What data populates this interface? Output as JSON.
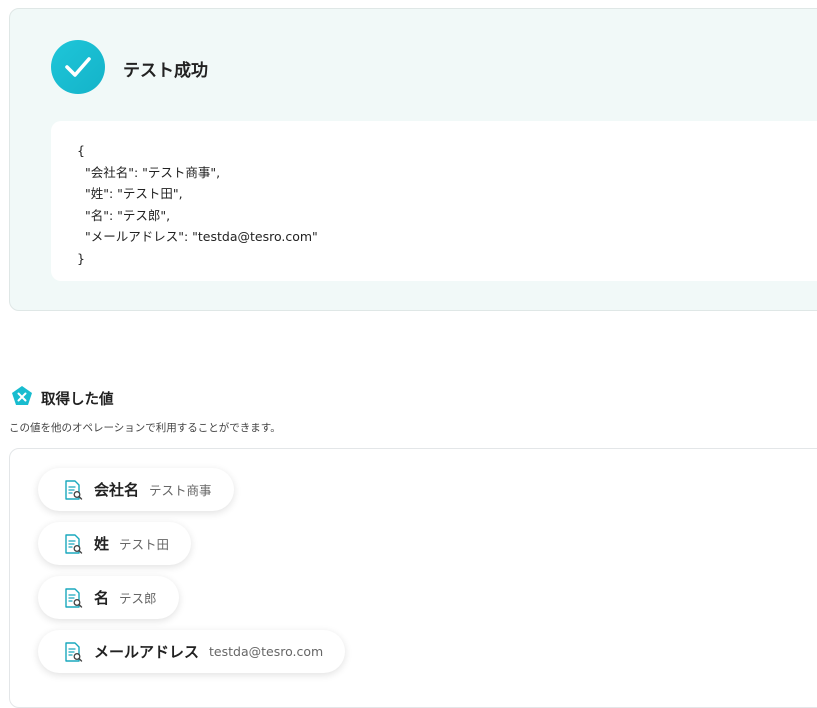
{
  "test_result": {
    "title": "テスト成功",
    "json_lines": [
      "{",
      "  \"会社名\": \"テスト商事\",",
      "  \"姓\": \"テスト田\",",
      "  \"名\": \"テス郎\",",
      "  \"メールアドレス\": \"testda@tesro.com\"",
      "}"
    ]
  },
  "acquired": {
    "title": "取得した値",
    "description": "この値を他のオペレーションで利用することができます。",
    "items": [
      {
        "label": "会社名",
        "value": "テスト商事"
      },
      {
        "label": "姓",
        "value": "テスト田"
      },
      {
        "label": "名",
        "value": "テス郎"
      },
      {
        "label": "メールアドレス",
        "value": "testda@tesro.com"
      }
    ]
  },
  "colors": {
    "accent": "#18bccf",
    "panel_bg": "#f1f9f8"
  },
  "icons": {
    "success": "check-icon",
    "section": "yoom-logo-icon",
    "item": "document-search-icon"
  }
}
